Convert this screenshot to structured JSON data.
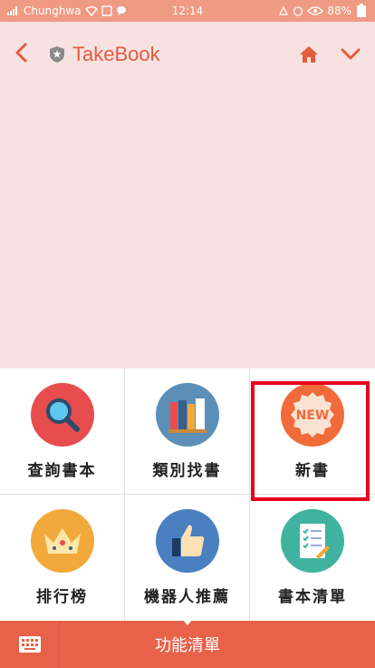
{
  "status_bar": {
    "carrier": "Chunghwa",
    "time": "12:14",
    "battery": "88%"
  },
  "header": {
    "title": "TakeBook"
  },
  "menu": {
    "items": [
      {
        "label": "查詢書本",
        "icon": "magnifier-icon",
        "color": "#e84d4d"
      },
      {
        "label": "類別找書",
        "icon": "books-icon",
        "color": "#5b8fb8"
      },
      {
        "label": "新書",
        "icon": "new-badge-icon",
        "color": "#f06a3a",
        "badge_text": "NEW"
      },
      {
        "label": "排行榜",
        "icon": "crown-icon",
        "color": "#f2a93b"
      },
      {
        "label": "機器人推薦",
        "icon": "thumbs-up-icon",
        "color": "#4a7fc1"
      },
      {
        "label": "書本清單",
        "icon": "checklist-icon",
        "color": "#3fb3a0"
      }
    ]
  },
  "bottom_bar": {
    "title": "功能清單"
  },
  "colors": {
    "accent": "#e8624a",
    "header_bg": "#f8e1e1",
    "highlight": "#e8001c"
  }
}
